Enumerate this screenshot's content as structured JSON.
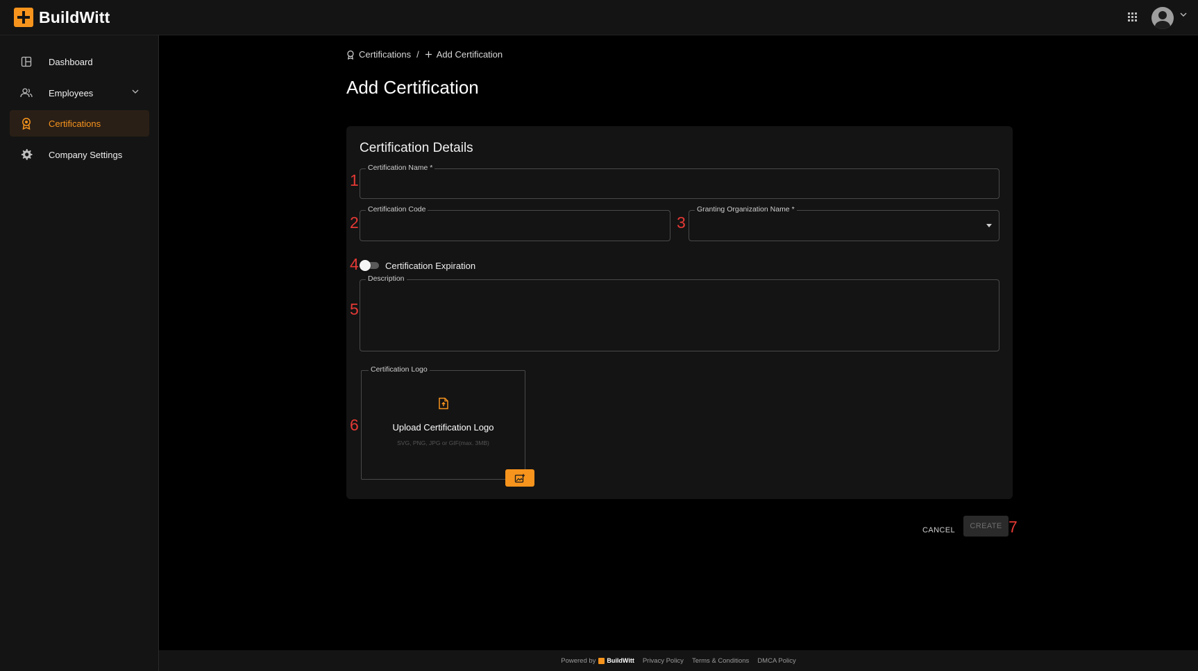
{
  "app": {
    "brand": "BuildWitt",
    "accent_color": "#f7941d"
  },
  "topbar": {
    "apps_icon": "apps-grid-icon",
    "avatar_icon": "user-avatar-icon",
    "avatar_menu_icon": "chevron-down-icon"
  },
  "sidebar": {
    "items": [
      {
        "label": "Dashboard",
        "icon": "dashboard-icon",
        "active": false
      },
      {
        "label": "Employees",
        "icon": "people-icon",
        "active": false,
        "expandable": true
      },
      {
        "label": "Certifications",
        "icon": "award-icon",
        "active": true
      },
      {
        "label": "Company Settings",
        "icon": "gear-icon",
        "active": false
      }
    ]
  },
  "breadcrumb": {
    "root": "Certifications",
    "separator": "/",
    "current": "Add Certification"
  },
  "page": {
    "title": "Add Certification"
  },
  "form": {
    "section_title": "Certification Details",
    "certification_name": {
      "label": "Certification Name *",
      "value": ""
    },
    "certification_code": {
      "label": "Certification Code",
      "value": ""
    },
    "granting_org": {
      "label": "Granting Organization Name *",
      "value": ""
    },
    "expiration_toggle": {
      "label": "Certification Expiration",
      "checked": false
    },
    "description": {
      "label": "Description",
      "value": ""
    },
    "logo": {
      "label": "Certification Logo",
      "title": "Upload Certification Logo",
      "hint": "SVG, PNG, JPG or GIF(max. 3MB)"
    },
    "markers": [
      "1",
      "2",
      "3",
      "4",
      "5",
      "6",
      "7"
    ]
  },
  "actions": {
    "cancel": "CANCEL",
    "create": "CREATE"
  },
  "footer": {
    "powered_by": "Powered by",
    "brand": "BuildWitt",
    "links": [
      "Privacy Policy",
      "Terms & Conditions",
      "DMCA Policy"
    ]
  }
}
